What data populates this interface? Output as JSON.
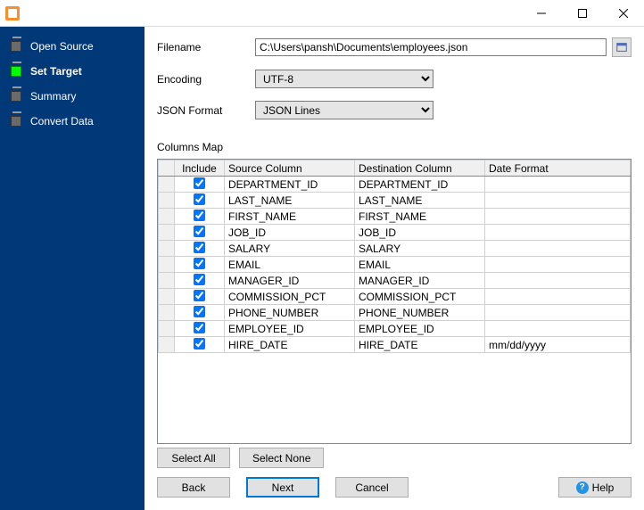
{
  "titlebar": {
    "title": ""
  },
  "sidebar": {
    "steps": [
      {
        "label": "Open Source",
        "active": false,
        "current": false
      },
      {
        "label": "Set Target",
        "active": true,
        "current": true
      },
      {
        "label": "Summary",
        "active": false,
        "current": false
      },
      {
        "label": "Convert Data",
        "active": false,
        "current": false
      }
    ]
  },
  "form": {
    "filename_label": "Filename",
    "filename_value": "C:\\Users\\pansh\\Documents\\employees.json",
    "encoding_label": "Encoding",
    "encoding_value": "UTF-8",
    "format_label": "JSON Format",
    "format_value": "JSON Lines"
  },
  "columns": {
    "section_label": "Columns Map",
    "headers": {
      "include": "Include",
      "source": "Source Column",
      "destination": "Destination Column",
      "date_format": "Date Format"
    },
    "rows": [
      {
        "include": true,
        "source": "DEPARTMENT_ID",
        "destination": "DEPARTMENT_ID",
        "date_format": ""
      },
      {
        "include": true,
        "source": "LAST_NAME",
        "destination": "LAST_NAME",
        "date_format": ""
      },
      {
        "include": true,
        "source": "FIRST_NAME",
        "destination": "FIRST_NAME",
        "date_format": ""
      },
      {
        "include": true,
        "source": "JOB_ID",
        "destination": "JOB_ID",
        "date_format": ""
      },
      {
        "include": true,
        "source": "SALARY",
        "destination": "SALARY",
        "date_format": ""
      },
      {
        "include": true,
        "source": "EMAIL",
        "destination": "EMAIL",
        "date_format": ""
      },
      {
        "include": true,
        "source": "MANAGER_ID",
        "destination": "MANAGER_ID",
        "date_format": ""
      },
      {
        "include": true,
        "source": "COMMISSION_PCT",
        "destination": "COMMISSION_PCT",
        "date_format": ""
      },
      {
        "include": true,
        "source": "PHONE_NUMBER",
        "destination": "PHONE_NUMBER",
        "date_format": ""
      },
      {
        "include": true,
        "source": "EMPLOYEE_ID",
        "destination": "EMPLOYEE_ID",
        "date_format": ""
      },
      {
        "include": true,
        "source": "HIRE_DATE",
        "destination": "HIRE_DATE",
        "date_format": "mm/dd/yyyy"
      }
    ]
  },
  "buttons": {
    "select_all": "Select All",
    "select_none": "Select None",
    "back": "Back",
    "next": "Next",
    "cancel": "Cancel",
    "help": "Help"
  }
}
